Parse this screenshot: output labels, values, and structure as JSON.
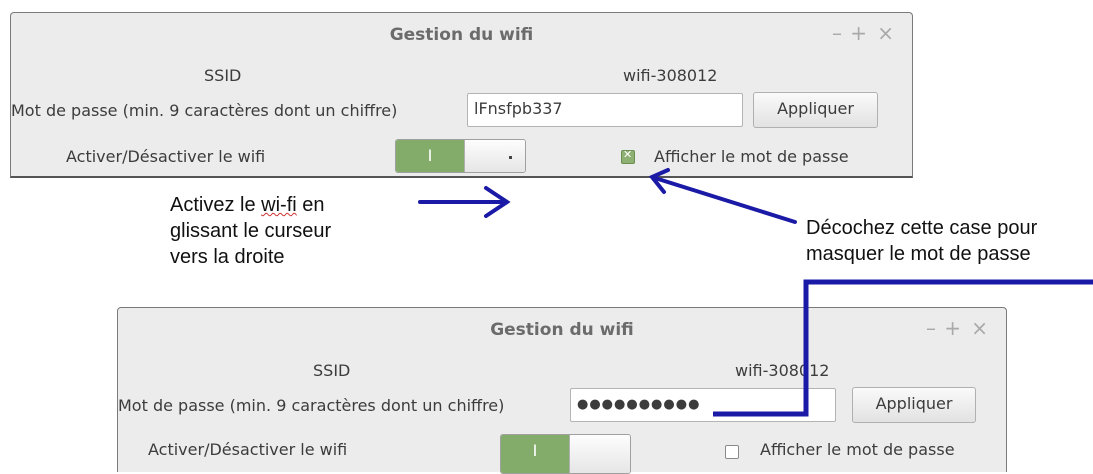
{
  "windows": {
    "w1": {
      "title": "Gestion du wifi",
      "controls": {
        "minimize": "–",
        "maximize": "+",
        "close": "×"
      },
      "ssid_label": "SSID",
      "ssid_value": "wifi-308012",
      "password_label": "Mot de passe (min. 9 caractères dont un chiffre)",
      "password_value": "lFnsfpb337",
      "apply_label": "Appliquer",
      "toggle_label": "Activer/Désactiver le wifi",
      "toggle_on_text": "I",
      "toggle_state": "on",
      "show_password_label": "Afficher le mot de passe",
      "show_password_checked": true
    },
    "w2": {
      "title": "Gestion du wifi",
      "controls": {
        "minimize": "–",
        "maximize": "+",
        "close": "×"
      },
      "ssid_label": "SSID",
      "ssid_value": "wifi-308012",
      "password_label": "Mot de passe (min. 9 caractères dont un chiffre)",
      "password_value": "●●●●●●●●●●",
      "apply_label": "Appliquer",
      "toggle_label": "Activer/Désactiver le wifi",
      "toggle_on_text": "I",
      "toggle_state": "on",
      "show_password_label": "Afficher le mot de passe",
      "show_password_checked": false
    }
  },
  "annotations": {
    "left_line1": "Activez le ",
    "left_squiggle": "wi-fi",
    "left_line1_end": " en",
    "left_line2": "glissant le curseur",
    "left_line3": "vers la droite",
    "right_line1": "Décochez cette case pour",
    "right_line2": "masquer le mot de passe",
    "arrow_color": "#1a1aa6"
  }
}
